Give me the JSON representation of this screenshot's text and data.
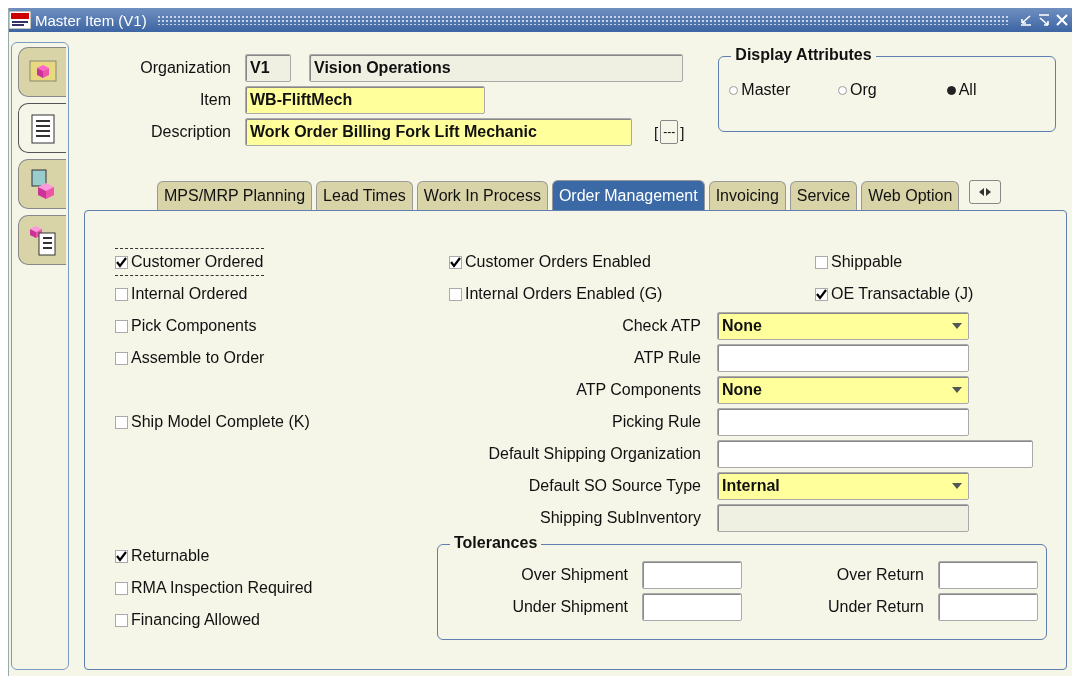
{
  "window": {
    "title": "Master Item (V1)"
  },
  "header": {
    "organization": {
      "label": "Organization",
      "code": "V1",
      "name": "Vision Operations"
    },
    "item": {
      "label": "Item",
      "value": "WB-FliftMech"
    },
    "description": {
      "label": "Description",
      "value": "Work Order Billing Fork Lift Mechanic",
      "bracket_open": "[",
      "button": "---",
      "bracket_close": "]"
    }
  },
  "display_attributes": {
    "title": "Display Attributes",
    "options": [
      {
        "label": "Master",
        "selected": false
      },
      {
        "label": "Org",
        "selected": false
      },
      {
        "label": "All",
        "selected": true
      }
    ]
  },
  "tabs": [
    {
      "label": "MPS/MRP Planning",
      "selected": false
    },
    {
      "label": "Lead Times",
      "selected": false
    },
    {
      "label": "Work In Process",
      "selected": false
    },
    {
      "label": "Order Management",
      "selected": true
    },
    {
      "label": "Invoicing",
      "selected": false
    },
    {
      "label": "Service",
      "selected": false
    },
    {
      "label": "Web Option",
      "selected": false
    }
  ],
  "rows": [
    {
      "left": {
        "label": "Customer Ordered",
        "checked": true,
        "focused": true
      },
      "middle": {
        "kind": "checkbox",
        "label": "Customer Orders Enabled",
        "checked": true,
        "focused": false
      },
      "right": {
        "label": "Shippable",
        "checked": false,
        "focused": false
      }
    },
    {
      "left": {
        "label": "Internal Ordered",
        "checked": false,
        "focused": false
      },
      "middle": {
        "kind": "checkbox",
        "label": "Internal Orders Enabled (G)",
        "checked": false,
        "focused": false
      },
      "right": {
        "label": "OE Transactable (J)",
        "checked": true,
        "focused": false
      }
    },
    {
      "left": {
        "label": "Pick Components",
        "checked": false,
        "focused": false
      },
      "middle": {
        "kind": "combo",
        "label": "Check ATP",
        "value": "None"
      }
    },
    {
      "left": {
        "label": "Assemble to Order",
        "checked": false,
        "focused": false
      },
      "middle": {
        "kind": "text",
        "label": "ATP Rule"
      }
    },
    {
      "middle": {
        "kind": "combo",
        "label": "ATP Components",
        "value": "None"
      }
    },
    {
      "left": {
        "label": "Ship Model Complete (K)",
        "checked": false,
        "focused": false
      },
      "middle": {
        "kind": "text",
        "label": "Picking Rule"
      }
    },
    {
      "middle": {
        "kind": "longtext",
        "label": "Default Shipping Organization"
      }
    },
    {
      "middle": {
        "kind": "combo",
        "label": "Default SO Source Type",
        "value": "Internal"
      }
    },
    {
      "middle": {
        "kind": "readonly",
        "label": "Shipping SubInventory"
      }
    }
  ],
  "bottom_checkboxes": [
    {
      "label": "Returnable",
      "checked": true,
      "focused": false
    },
    {
      "label": "RMA Inspection Required",
      "checked": false,
      "focused": false
    },
    {
      "label": "Financing Allowed",
      "checked": false,
      "focused": false
    }
  ],
  "tolerances": {
    "title": "Tolerances",
    "fields": [
      {
        "label": "Over Shipment"
      },
      {
        "label": "Over Return"
      },
      {
        "label": "Under Shipment"
      },
      {
        "label": "Under Return"
      }
    ]
  }
}
